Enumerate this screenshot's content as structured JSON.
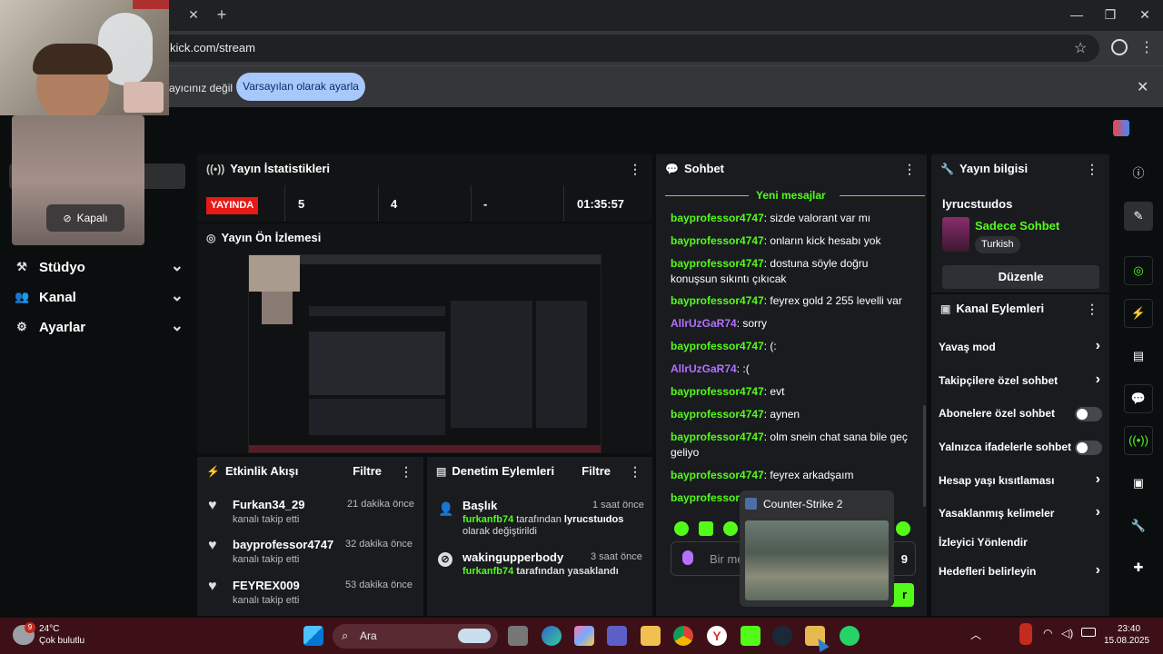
{
  "browser": {
    "url": "kick.com/stream",
    "infobar_message": "ayıcınız değil",
    "infobar_button": "Varsayılan olarak ayarla"
  },
  "webcam": {
    "off_label": "Kapalı"
  },
  "sidebar": {
    "items": [
      {
        "label": "Stüdyo",
        "icon": "wrench-icon"
      },
      {
        "label": "Kanal",
        "icon": "users-icon"
      },
      {
        "label": "Ayarlar",
        "icon": "gear-icon"
      }
    ]
  },
  "stats": {
    "title": "Yayın İstatistikleri",
    "live_badge": "YAYINDA",
    "values": [
      "5",
      "4",
      "-",
      "01:35:57"
    ]
  },
  "preview": {
    "title": "Yayın Ön İzlemesi"
  },
  "activity": {
    "title": "Etkinlik Akışı",
    "filter": "Filtre",
    "events": [
      {
        "name": "Furkan34_29",
        "sub": "kanalı takip etti",
        "time": "21 dakika önce"
      },
      {
        "name": "bayprofessor4747",
        "sub": "kanalı takip etti",
        "time": "32 dakika önce"
      },
      {
        "name": "FEYREX009",
        "sub": "kanalı takip etti",
        "time": "53 dakika önce"
      }
    ]
  },
  "moderation": {
    "title": "Denetim Eylemleri",
    "filter": "Filtre",
    "events": [
      {
        "name": "Başlık",
        "time": "1 saat önce",
        "actor": "furkanfb74",
        "text": " tarafından ",
        "target": "lyrucstuıdos",
        "text2": "olarak değiştirildi"
      },
      {
        "name": "wakingupperbody",
        "time": "3 saat önce",
        "actor": "furkanfb74",
        "text": " tarafından yasaklandı"
      }
    ]
  },
  "chat": {
    "title": "Sohbet",
    "new_messages": "Yeni mesajlar",
    "messages": [
      {
        "user": "bayprofessor4747",
        "text": ": sizde valorant var mı"
      },
      {
        "user": "bayprofessor4747",
        "text": ": onların kick hesabı yok"
      },
      {
        "user": "bayprofessor4747",
        "text": ": dostuna söyle doğru konuşsun sıkıntı çıkıcak"
      },
      {
        "user": "bayprofessor4747",
        "text": ": feyrex gold 2 255 levelli var"
      },
      {
        "user": "AllrUzGaR74",
        "text": ": sorry"
      },
      {
        "user": "bayprofessor4747",
        "text": ": (:"
      },
      {
        "user": "AllrUzGaR74",
        "text": ": :("
      },
      {
        "user": "bayprofessor4747",
        "text": ": evt"
      },
      {
        "user": "bayprofessor4747",
        "text": ": aynen"
      },
      {
        "user": "bayprofessor4747",
        "text": ": olm snein chat sana bile geç geliyo"
      },
      {
        "user": "bayprofessor4747",
        "text": ": feyrex arkadşaım"
      },
      {
        "user": "bayprofessor4",
        "text": ""
      }
    ],
    "input_placeholder": "Bir me",
    "char_count": "9",
    "send_label": "r"
  },
  "info": {
    "title": "Yayın bilgisi",
    "channel": "lyrucstuıdos",
    "category": "Sadece Sohbet",
    "tag": "Turkish",
    "edit_button": "Düzenle"
  },
  "actions": {
    "title": "Kanal Eylemleri",
    "items": [
      {
        "label": "Yavaş mod",
        "control": "chevron"
      },
      {
        "label": "Takipçilere özel sohbet",
        "control": "chevron"
      },
      {
        "label": "Abonelere özel sohbet",
        "control": "toggle"
      },
      {
        "label": "Yalnızca ifadelerle sohbet",
        "control": "toggle"
      },
      {
        "label": "Hesap yaşı kısıtlaması",
        "control": "chevron"
      },
      {
        "label": "Yasaklanmış kelimeler",
        "control": "chevron"
      },
      {
        "label": "İzleyici Yönlendir",
        "control": "none"
      },
      {
        "label": "Hedefleri belirleyin",
        "control": "chevron"
      }
    ]
  },
  "hover_preview": {
    "title": "Counter-Strike 2"
  },
  "taskbar": {
    "temperature": "24°C",
    "weather": "Çok bulutlu",
    "weather_badge": "9",
    "search": "Ara",
    "time": "23:40",
    "date": "15.08.2025"
  },
  "colors": {
    "accent": "#53fc18",
    "live": "#e91916",
    "purple_user": "#b470ff"
  }
}
